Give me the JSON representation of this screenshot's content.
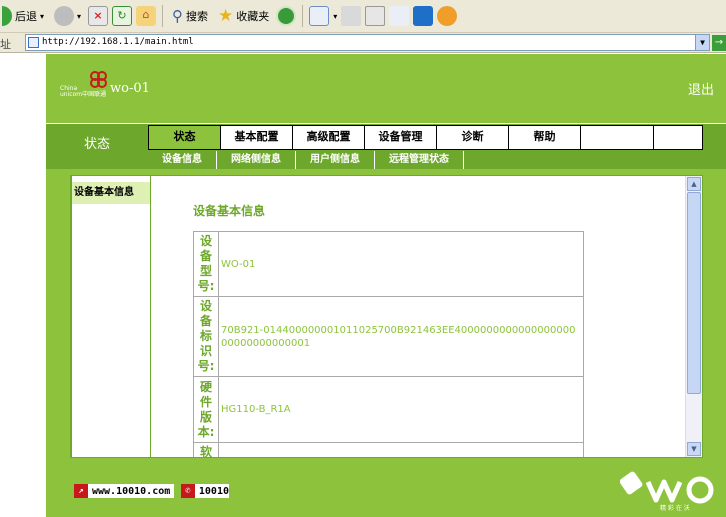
{
  "browser": {
    "back_label": "后退",
    "search_label": "搜索",
    "favorites_label": "收藏夹",
    "address_label": "址",
    "address_url": "http://192.168.1.1/main.html"
  },
  "header": {
    "device_name": "wo-01",
    "logout_label": "退出"
  },
  "nav": {
    "section_title": "状态",
    "tabs": [
      "状态",
      "基本配置",
      "高级配置",
      "设备管理",
      "诊断",
      "帮助"
    ],
    "subtabs": [
      "设备信息",
      "网络侧信息",
      "用户侧信息",
      "远程管理状态"
    ]
  },
  "sidebar": {
    "items": [
      "设备基本信息"
    ]
  },
  "content": {
    "title": "设备基本信息",
    "rows": [
      {
        "label": "设备型号:",
        "value": "WO-01"
      },
      {
        "label": "设备标识号:",
        "value": "70B921-014400000001011025700B921463EE400000000000000000000000000000001"
      },
      {
        "label": "硬件版本:",
        "value": "HG110-B_R1A"
      },
      {
        "label": "软",
        "value": ""
      }
    ]
  },
  "footer": {
    "link_website": "www.10010.com",
    "link_phone": "10010"
  },
  "colors": {
    "brand_green": "#8dc33c",
    "dark_green": "#6da72b"
  }
}
